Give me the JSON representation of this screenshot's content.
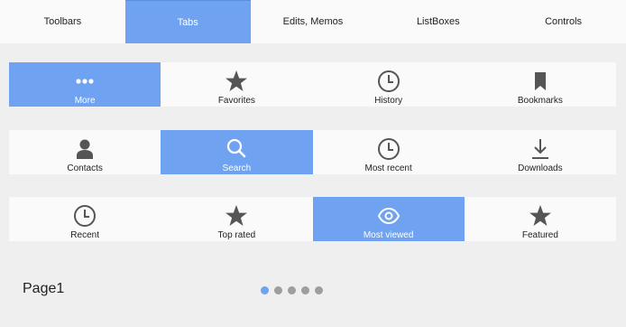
{
  "top_tabs": [
    {
      "label": "Toolbars",
      "active": false
    },
    {
      "label": "Tabs",
      "active": true
    },
    {
      "label": "Edits, Memos",
      "active": false
    },
    {
      "label": "ListBoxes",
      "active": false
    },
    {
      "label": "Controls",
      "active": false
    }
  ],
  "rows": [
    [
      {
        "label": "More",
        "icon": "more-icon",
        "active": true
      },
      {
        "label": "Favorites",
        "icon": "star-icon",
        "active": false
      },
      {
        "label": "History",
        "icon": "clock-icon",
        "active": false
      },
      {
        "label": "Bookmarks",
        "icon": "bookmark-icon",
        "active": false
      }
    ],
    [
      {
        "label": "Contacts",
        "icon": "person-icon",
        "active": false
      },
      {
        "label": "Search",
        "icon": "search-icon",
        "active": true
      },
      {
        "label": "Most recent",
        "icon": "clock-icon",
        "active": false
      },
      {
        "label": "Downloads",
        "icon": "download-icon",
        "active": false
      }
    ],
    [
      {
        "label": "Recent",
        "icon": "clock-icon",
        "active": false
      },
      {
        "label": "Top rated",
        "icon": "star-icon",
        "active": false
      },
      {
        "label": "Most viewed",
        "icon": "eye-icon",
        "active": true
      },
      {
        "label": "Featured",
        "icon": "star-icon",
        "active": false
      }
    ]
  ],
  "page": {
    "label": "Page1",
    "dot_count": 5,
    "active_dot": 0
  },
  "colors": {
    "accent": "#6fa2f0",
    "background": "#efefef",
    "bar": "#fafafa",
    "icon_dark": "#555555",
    "dot_inactive": "#9e9e9e"
  }
}
